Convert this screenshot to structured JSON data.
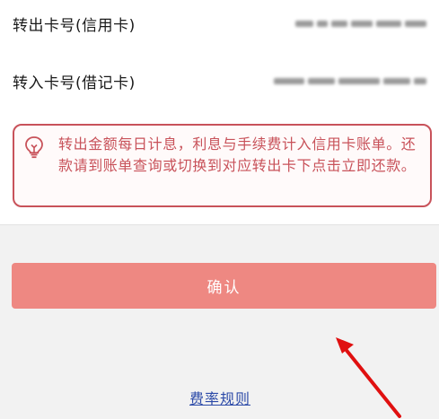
{
  "transfer_out": {
    "label": "转出卡号(信用卡)"
  },
  "transfer_in": {
    "label": "转入卡号(借记卡)"
  },
  "notice": {
    "icon": "lightbulb-icon",
    "text": "转出金额每日计息，利息与手续费计入信用卡账单。还款请到账单查询或切换到对应转出卡下点击立即还款。"
  },
  "actions": {
    "confirm_label": "确认",
    "rules_label": "费率规则"
  },
  "colors": {
    "accent_red": "#c8525a",
    "button_bg": "#ee8882",
    "link_blue": "#2c4aa8",
    "annotation_arrow": "#e01010"
  }
}
